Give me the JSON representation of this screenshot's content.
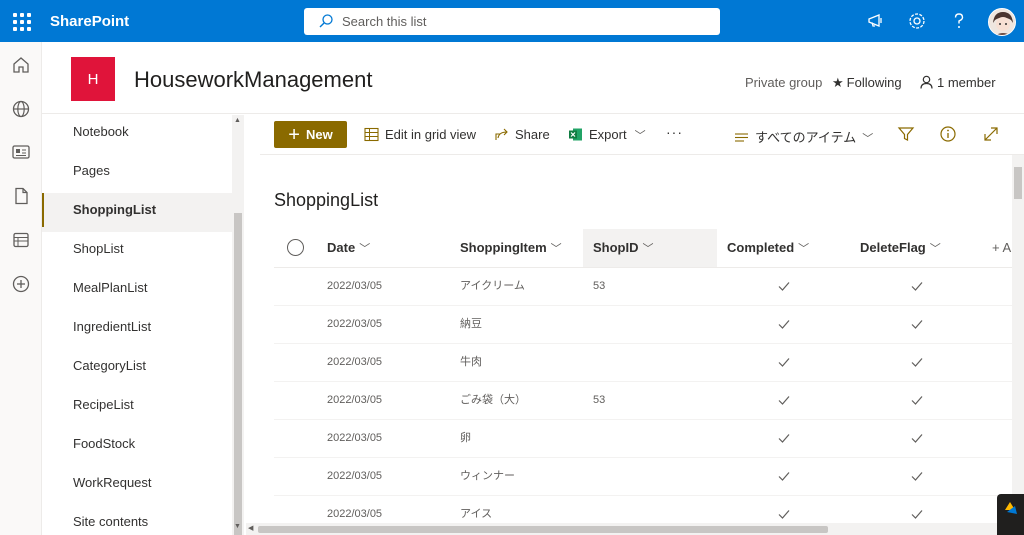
{
  "suite": {
    "brand": "SharePoint",
    "search_placeholder": "Search this list"
  },
  "site": {
    "logo_letter": "H",
    "title": "HouseworkManagement",
    "privacy": "Private group",
    "following_label": "Following",
    "members_label": "1 member"
  },
  "nav": {
    "items": [
      {
        "label": "Notebook",
        "active": false
      },
      {
        "label": "Pages",
        "active": false
      },
      {
        "label": "ShoppingList",
        "active": true
      },
      {
        "label": "ShopList",
        "active": false
      },
      {
        "label": "MealPlanList",
        "active": false
      },
      {
        "label": "IngredientList",
        "active": false
      },
      {
        "label": "CategoryList",
        "active": false
      },
      {
        "label": "RecipeList",
        "active": false
      },
      {
        "label": "FoodStock",
        "active": false
      },
      {
        "label": "WorkRequest",
        "active": false
      },
      {
        "label": "Site contents",
        "active": false
      }
    ]
  },
  "commands": {
    "new_label": "New",
    "edit_grid_label": "Edit in grid view",
    "share_label": "Share",
    "export_label": "Export",
    "more_label": "···",
    "view_label": "すべてのアイテム"
  },
  "list": {
    "title": "ShoppingList",
    "columns": {
      "date": "Date",
      "item": "ShoppingItem",
      "shop": "ShopID",
      "completed": "Completed",
      "deleteflag": "DeleteFlag",
      "add": "+ A"
    },
    "rows": [
      {
        "date": "2022/03/05",
        "item": "アイクリーム",
        "shop": "53",
        "completed": true,
        "deleteflag": true
      },
      {
        "date": "2022/03/05",
        "item": "納豆",
        "shop": "",
        "completed": true,
        "deleteflag": true
      },
      {
        "date": "2022/03/05",
        "item": "牛肉",
        "shop": "",
        "completed": true,
        "deleteflag": true
      },
      {
        "date": "2022/03/05",
        "item": "ごみ袋（大）",
        "shop": "53",
        "completed": true,
        "deleteflag": true
      },
      {
        "date": "2022/03/05",
        "item": "卵",
        "shop": "",
        "completed": true,
        "deleteflag": true
      },
      {
        "date": "2022/03/05",
        "item": "ウィンナー",
        "shop": "",
        "completed": true,
        "deleteflag": true
      },
      {
        "date": "2022/03/05",
        "item": "アイス",
        "shop": "",
        "completed": true,
        "deleteflag": true
      }
    ]
  },
  "colors": {
    "suite_blue": "#0078d4",
    "site_logo": "#e0143a",
    "accent_gold": "#8a6a00"
  },
  "icons": [
    "waffle-icon",
    "search-icon",
    "megaphone-icon",
    "gear-icon",
    "help-icon",
    "home-icon",
    "globe-icon",
    "news-icon",
    "document-icon",
    "lists-icon",
    "add-icon",
    "star-icon",
    "person-icon",
    "grid-icon",
    "share-icon",
    "excel-icon",
    "view-lines-icon",
    "filter-icon",
    "info-icon",
    "expand-icon",
    "checkmark-icon"
  ]
}
